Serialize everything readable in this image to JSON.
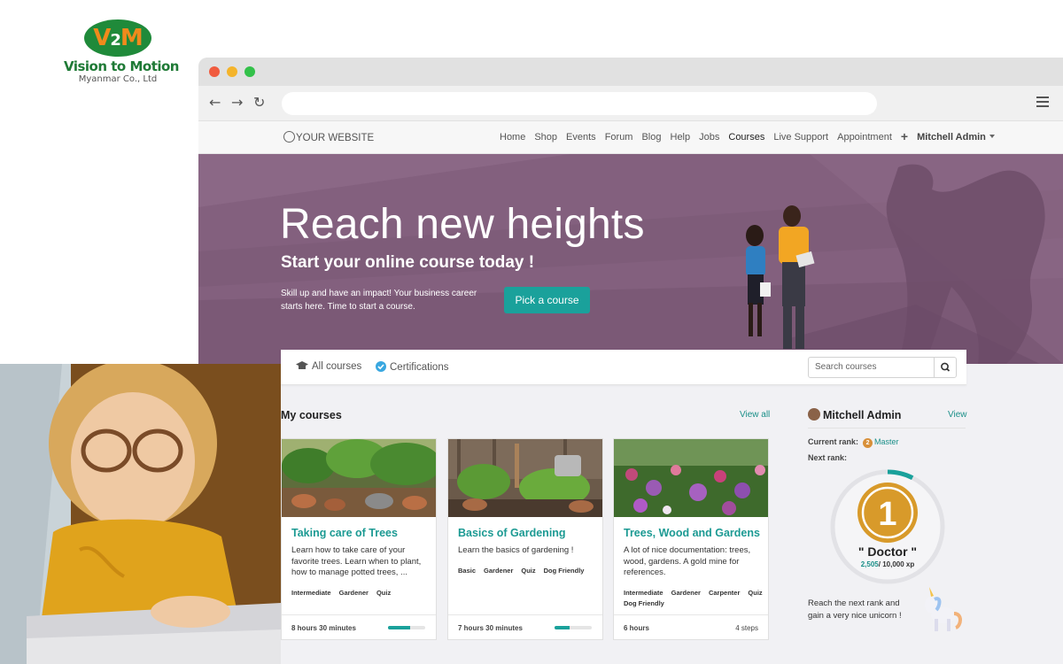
{
  "logo": {
    "mark": "V2M",
    "name": "Vision to Motion",
    "sub": "Myanmar Co., Ltd"
  },
  "browser": {
    "dots": [
      "red",
      "yellow",
      "green"
    ],
    "nav_icons": [
      "back-arrow-icon",
      "forward-arrow-icon",
      "reload-icon"
    ],
    "url": ""
  },
  "site": {
    "brand": "YOUR WEBSITE",
    "menu": [
      "Home",
      "Shop",
      "Events",
      "Forum",
      "Blog",
      "Help",
      "Jobs",
      "Courses",
      "Live Support",
      "Appointment"
    ],
    "active_menu": "Courses",
    "user": "Mitchell Admin"
  },
  "hero": {
    "title": "Reach new heights",
    "subtitle": "Start your online course today !",
    "text": "Skill up and have an impact! Your business career starts here. Time to start a course.",
    "button": "Pick a course"
  },
  "tabs": {
    "all": "All courses",
    "certifications": "Certifications",
    "search_placeholder": "Search courses"
  },
  "main": {
    "title": "My courses",
    "view_all": "View all",
    "courses": [
      {
        "title": "Taking care of Trees",
        "description": "Learn how to take care of your favorite trees. Learn when to plant, how to manage potted trees, ...",
        "tags": [
          "Intermediate",
          "Gardener",
          "Quiz"
        ],
        "duration": "8 hours 30 minutes",
        "steps": "",
        "progress": 0.6
      },
      {
        "title": "Basics of Gardening",
        "description": "Learn the basics of gardening !",
        "tags": [
          "Basic",
          "Gardener",
          "Quiz",
          "Dog Friendly"
        ],
        "duration": "7 hours 30 minutes",
        "steps": "",
        "progress": 0.4
      },
      {
        "title": "Trees, Wood and Gardens",
        "description": "A lot of nice documentation: trees, wood, gardens. A gold mine for references.",
        "tags": [
          "Intermediate",
          "Gardener",
          "Carpenter",
          "Quiz",
          "Dog Friendly"
        ],
        "duration": "6 hours",
        "steps": "4 steps",
        "progress": null
      }
    ]
  },
  "profile": {
    "name": "Mitchell Admin",
    "view": "View",
    "current_rank_label": "Current rank:",
    "current_rank_badge": "2",
    "current_rank": "Master",
    "next_rank_label": "Next rank:",
    "next_rank_number": "1",
    "next_rank": "\" Doctor \"",
    "xp_current": "2,505",
    "xp_total": "/ 10,000 xp",
    "xp_progress": 0.25,
    "reach_text": "Reach the next rank and gain a very nice unicorn !"
  },
  "colors": {
    "accent": "#1aa19b",
    "hero": "#83607e",
    "gold": "#d89a2a",
    "logo_green": "#1f8a3a",
    "logo_orange": "#f08a1c"
  }
}
